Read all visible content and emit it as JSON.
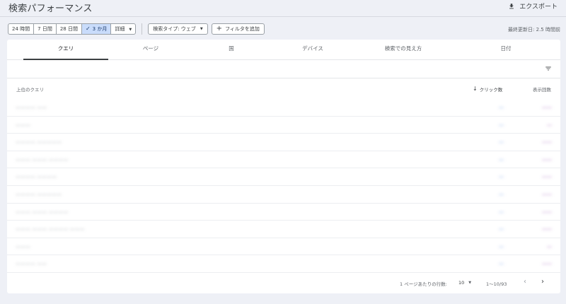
{
  "header": {
    "title": "検索パフォーマンス",
    "export_label": "エクスポート"
  },
  "date_range": {
    "options": [
      "24 時間",
      "7 日間",
      "28 日間",
      "3 か月",
      "詳細"
    ],
    "selected": "3 か月"
  },
  "filters": {
    "search_type": "検索タイプ: ウェブ",
    "add_filter": "フィルタを追加"
  },
  "last_updated": "最終更新日: 2.5 時間前",
  "tabs": [
    "クエリ",
    "ページ",
    "国",
    "デバイス",
    "検索での見え方",
    "日付"
  ],
  "active_tab": "クエリ",
  "table": {
    "headers": {
      "query": "上位のクエリ",
      "clicks": "クリック数",
      "impressions": "表示回数"
    },
    "rows": [
      {
        "query": "ーーーー ーー",
        "clicks": "—",
        "impressions": "——"
      },
      {
        "query": "ーーー",
        "clicks": "—",
        "impressions": "—"
      },
      {
        "query": "ーーーー ーーーーー",
        "clicks": "—",
        "impressions": "——"
      },
      {
        "query": "ーーー ーーー ーーーー",
        "clicks": "—",
        "impressions": "——"
      },
      {
        "query": "ーーーー ーーーー",
        "clicks": "—",
        "impressions": "——"
      },
      {
        "query": "ーーーー ーーーーー",
        "clicks": "—",
        "impressions": "——"
      },
      {
        "query": "ーーー ーーー ーーーー",
        "clicks": "—",
        "impressions": "——"
      },
      {
        "query": "ーーー ーーー ーーーー ーーー",
        "clicks": "—",
        "impressions": "——"
      },
      {
        "query": "ーーー",
        "clicks": "—",
        "impressions": "—"
      },
      {
        "query": "ーーーー ーー",
        "clicks": "—",
        "impressions": "——"
      }
    ]
  },
  "pagination": {
    "rows_label": "1 ページあたりの行数:",
    "rows_per_page": "10",
    "range": "1～10/93",
    "prev": "‹",
    "next": "›"
  },
  "icons": {
    "export": "download-icon",
    "filter": "filter-list-icon",
    "sort": "arrow-downward-icon"
  },
  "colors": {
    "accent_selected": "#c9dcfb",
    "clicks": "#4a7fe0",
    "impressions": "#8e44ad"
  }
}
